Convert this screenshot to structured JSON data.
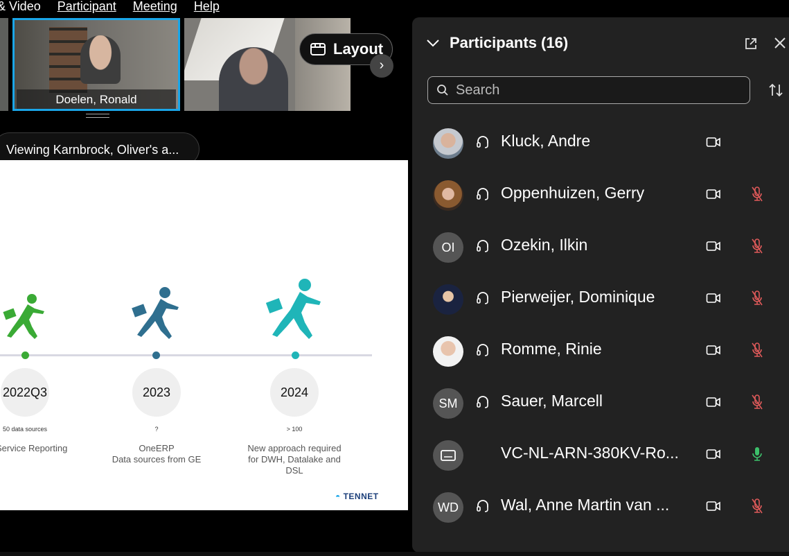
{
  "menu": {
    "items": [
      "& Video",
      "Participant",
      "Meeting",
      "Help"
    ]
  },
  "thumbnails": {
    "active_name": "Doelen, Ronald"
  },
  "layout_button": {
    "label": "Layout"
  },
  "viewing_pill": {
    "text": "Viewing Karnbrock, Oliver's a..."
  },
  "slide": {
    "milestones": [
      {
        "year": "2022Q3",
        "note": "50 data sources",
        "caption": "Service Reporting",
        "color": "#3aaa35"
      },
      {
        "year": "2023",
        "note": "?",
        "caption": "OneERP\nData sources from GE",
        "color": "#2f6f8f"
      },
      {
        "year": "2024",
        "note": "> 100",
        "caption": "New approach required\nfor DWH, Datalake and\nDSL",
        "color": "#1fb5b8"
      }
    ],
    "logo": "TENNET"
  },
  "panel": {
    "title": "Participants (16)",
    "search_placeholder": "Search",
    "participants": [
      {
        "name": "Kluck, Andre",
        "avatar": "photo",
        "initials": "",
        "audio": true,
        "mic": "none"
      },
      {
        "name": "Oppenhuizen, Gerry",
        "avatar": "photo",
        "initials": "",
        "audio": true,
        "mic": "muted"
      },
      {
        "name": "Ozekin, Ilkin",
        "avatar": "initials",
        "initials": "OI",
        "audio": true,
        "mic": "muted"
      },
      {
        "name": "Pierweijer, Dominique",
        "avatar": "photo",
        "initials": "",
        "audio": true,
        "mic": "muted"
      },
      {
        "name": "Romme, Rinie",
        "avatar": "photo",
        "initials": "",
        "audio": true,
        "mic": "muted"
      },
      {
        "name": "Sauer, Marcell",
        "avatar": "initials",
        "initials": "SM",
        "audio": true,
        "mic": "muted"
      },
      {
        "name": "VC-NL-ARN-380KV-Ro...",
        "avatar": "device",
        "initials": "",
        "audio": false,
        "mic": "active"
      },
      {
        "name": "Wal, Anne Martin van ...",
        "avatar": "initials",
        "initials": "WD",
        "audio": true,
        "mic": "muted"
      }
    ]
  },
  "colors": {
    "accent": "#1aa6e8",
    "muted_mic": "#e05a5a",
    "active_mic": "#3cbf6a",
    "panel_bg": "#222222"
  }
}
